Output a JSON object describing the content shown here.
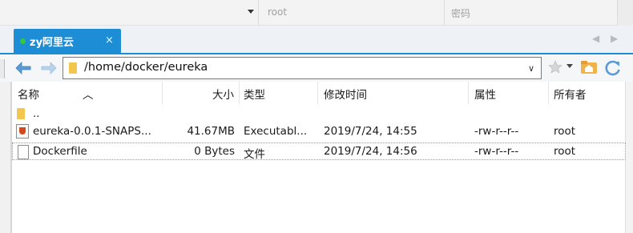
{
  "login": {
    "user_placeholder": "root",
    "password_placeholder": "密码"
  },
  "tab": {
    "label": "zy阿里云",
    "close": "×",
    "nav_prev": "◀",
    "nav_next": "▶"
  },
  "toolbar": {
    "back": "←",
    "forward": "→",
    "path": "/home/docker/eureka",
    "path_dropdown": "∨"
  },
  "columns": {
    "name": "名称",
    "size": "大小",
    "type": "类型",
    "modified": "修改时间",
    "attributes": "属性",
    "owner": "所有者"
  },
  "rows": [
    {
      "name": "..",
      "size": "",
      "type": "",
      "modified": "",
      "attributes": "",
      "owner": ""
    },
    {
      "name": "eureka-0.0.1-SNAPS...",
      "size": "41.67MB",
      "type": "Executabl...",
      "modified": "2019/7/24, 14:55",
      "attributes": "-rw-r--r--",
      "owner": "root"
    },
    {
      "name": "Dockerfile",
      "size": "0 Bytes",
      "type": "文件",
      "modified": "2019/7/24, 14:56",
      "attributes": "-rw-r--r--",
      "owner": "root"
    }
  ],
  "colors": {
    "accent": "#1d8dd6",
    "online": "#34c93a",
    "folder": "#f3c64d"
  }
}
